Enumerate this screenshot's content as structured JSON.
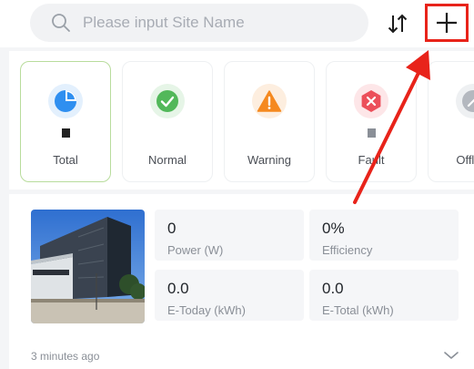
{
  "search": {
    "placeholder": "Please input Site Name"
  },
  "toolbar": {
    "sort_icon": "sort-arrows-icon",
    "add_icon": "plus-icon"
  },
  "status_cards": [
    {
      "label": "Total",
      "icon": "pie-chart-icon",
      "color": "#2f8ff0",
      "tint": "#e3f0fd",
      "selected": true
    },
    {
      "label": "Normal",
      "icon": "check-circle-icon",
      "color": "#52b85a",
      "tint": "#e6f5e7"
    },
    {
      "label": "Warning",
      "icon": "warning-triangle-icon",
      "color": "#f5891f",
      "tint": "#fdeedf"
    },
    {
      "label": "Fault",
      "icon": "fault-hexagon-icon",
      "color": "#ec4f5a",
      "tint": "#fde6e8"
    },
    {
      "label": "Offline",
      "icon": "offline-link-icon",
      "color": "#b4b8bf",
      "tint": "#eef0f2"
    }
  ],
  "site": {
    "metrics": {
      "power": {
        "value": "0",
        "label": "Power (W)"
      },
      "efficiency": {
        "value": "0%",
        "label": "Efficiency"
      },
      "e_today": {
        "value": "0.0",
        "label": "E-Today (kWh)"
      },
      "e_total": {
        "value": "0.0",
        "label": "E-Total (kWh)"
      }
    },
    "updated": "3 minutes ago"
  },
  "colors": {
    "highlight": "#e8231a",
    "active_card_border": "#b8dc9c"
  }
}
